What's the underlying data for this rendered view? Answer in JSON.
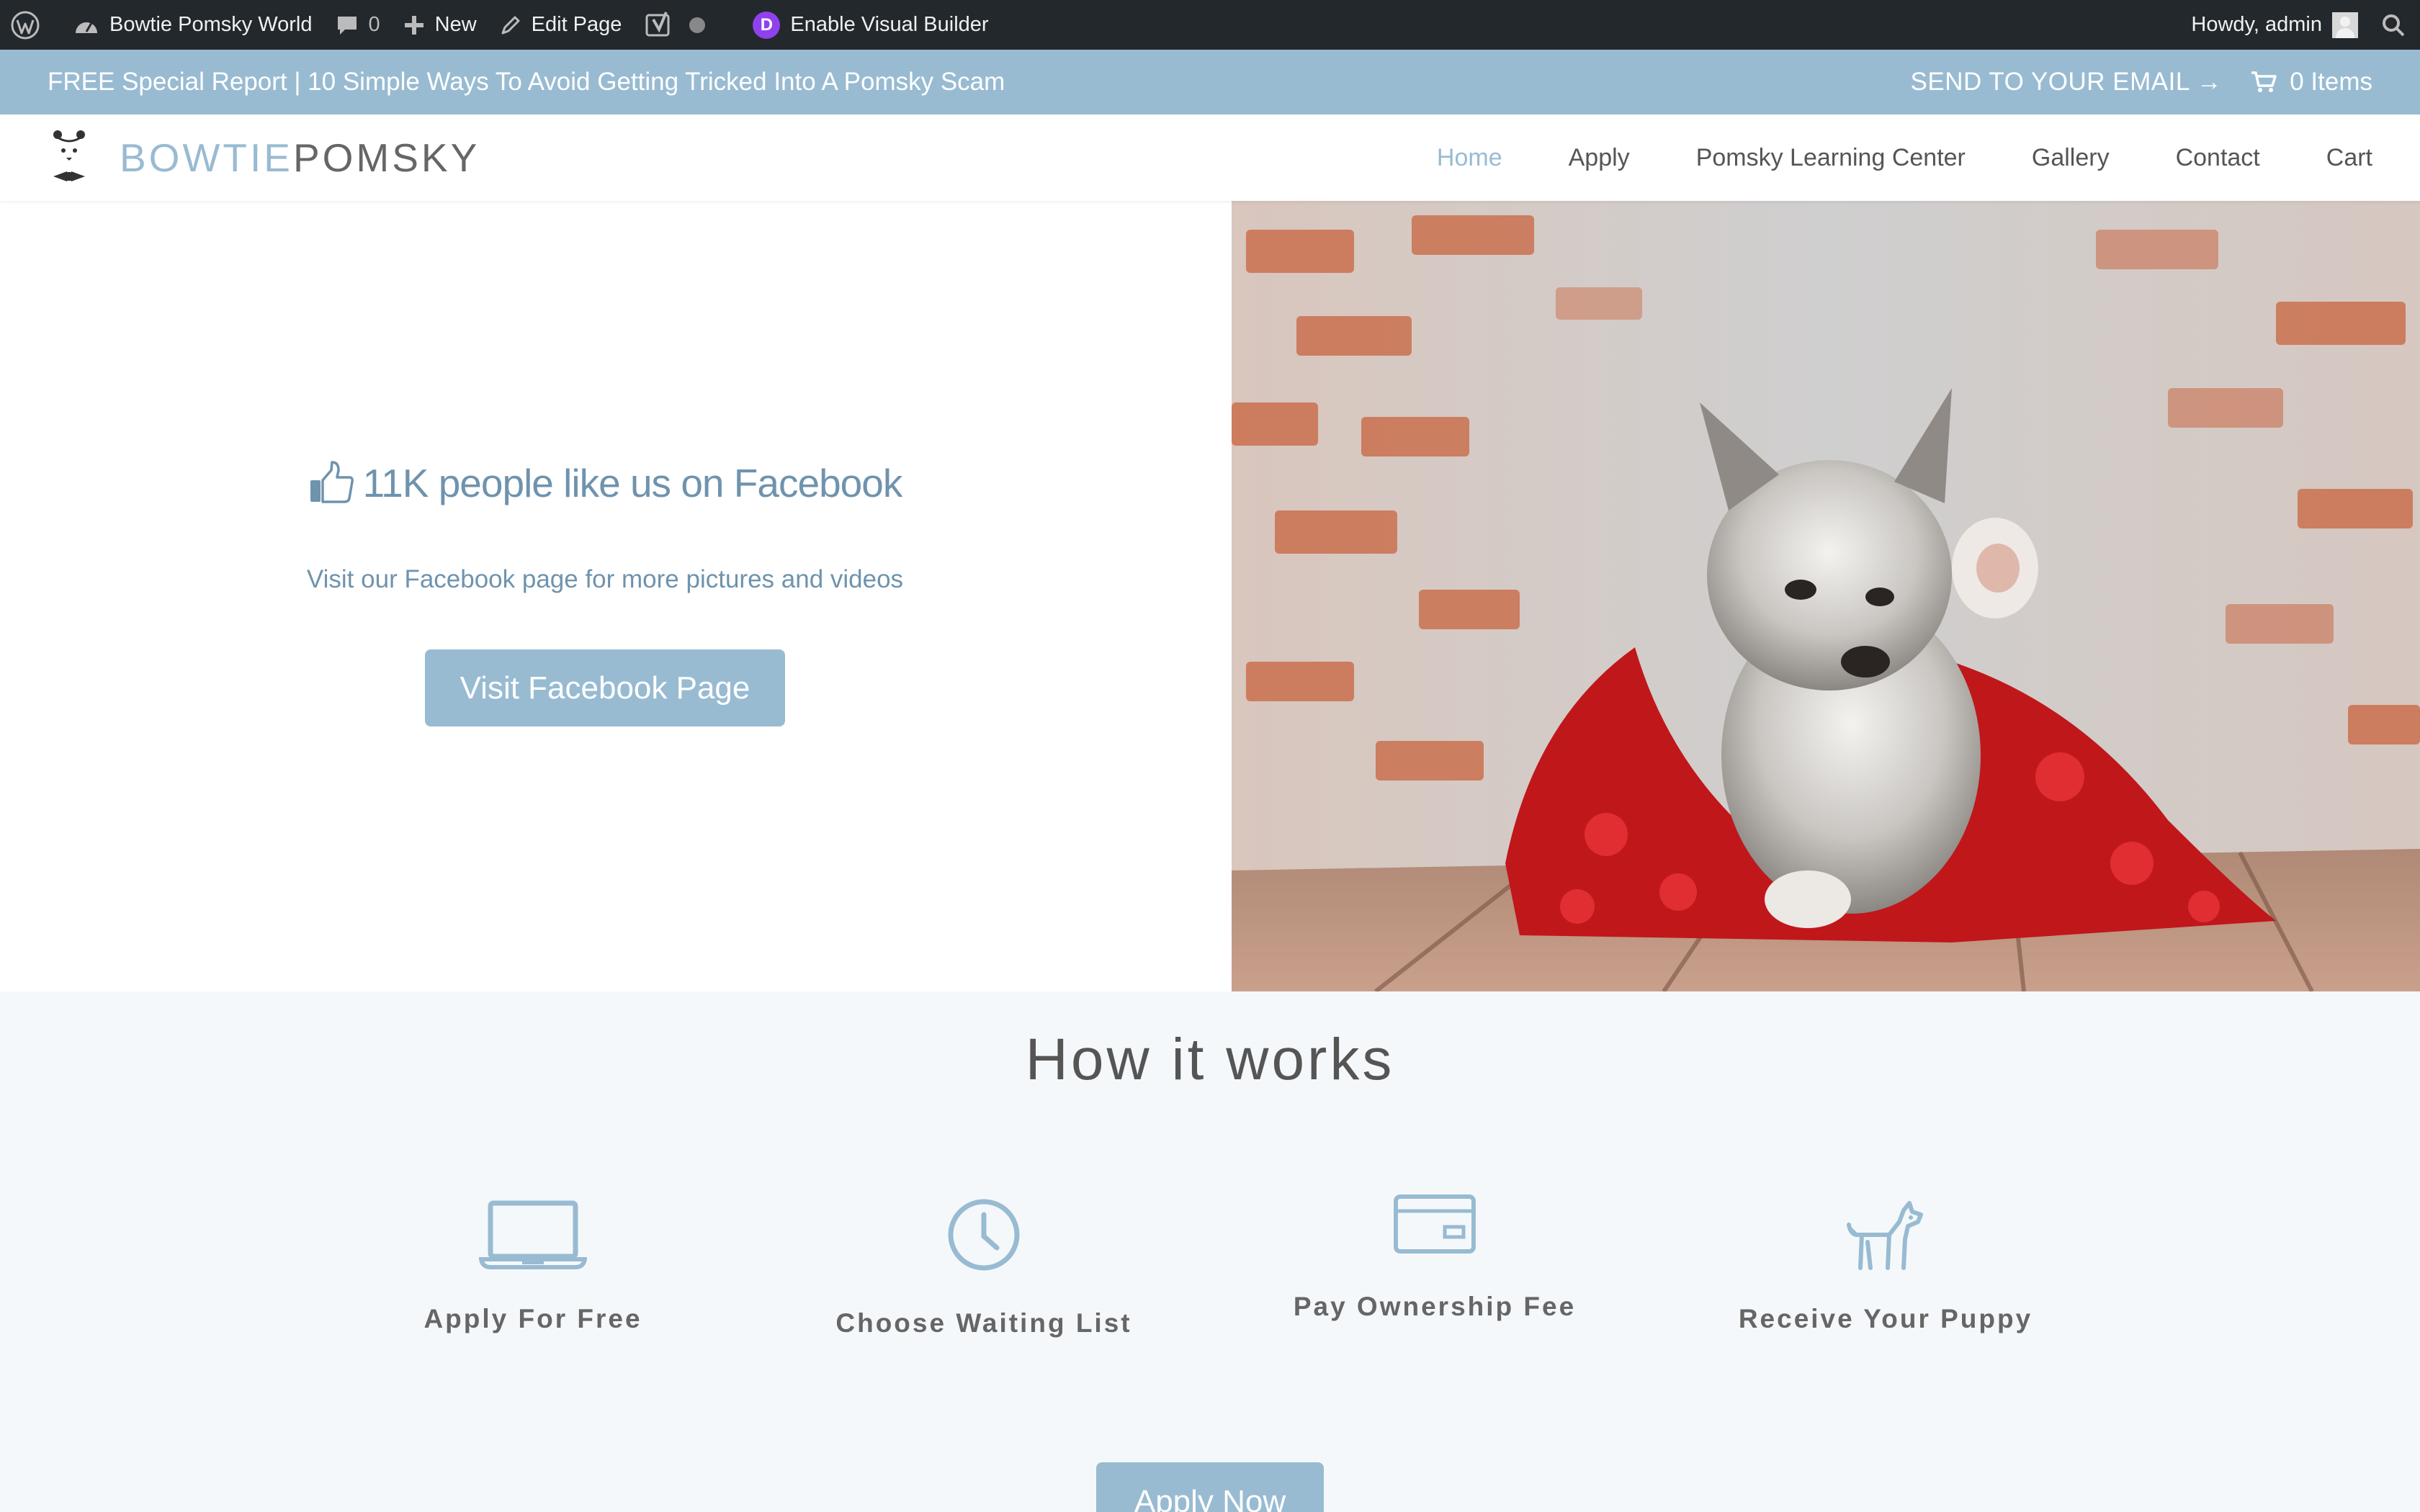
{
  "admin_bar": {
    "site_name": "Bowtie Pomsky World",
    "comments_count": "0",
    "new_label": "New",
    "edit_label": "Edit Page",
    "builder_label": "Enable Visual Builder",
    "divi_letter": "D",
    "howdy": "Howdy, admin",
    "icons": [
      "wordpress-icon",
      "dashboard-icon",
      "comment-icon",
      "plus-icon",
      "pencil-icon",
      "yoast-icon",
      "status-dot-icon",
      "divi-icon",
      "avatar",
      "search-icon"
    ]
  },
  "promo_bar": {
    "text": "FREE Special Report | 10 Simple Ways To Avoid Getting Tricked Into A Pomsky Scam",
    "email_cta": "SEND TO YOUR EMAIL →",
    "cart_label": "0 Items"
  },
  "header": {
    "logo_part1": "BOWTIE",
    "logo_part2": "POMSKY",
    "nav": [
      {
        "label": "Home",
        "active": true
      },
      {
        "label": "Apply"
      },
      {
        "label": "Pomsky Learning Center"
      },
      {
        "label": "Gallery"
      },
      {
        "label": "Contact"
      },
      {
        "label": "Cart"
      }
    ]
  },
  "hero": {
    "title": "11K people like us on Facebook",
    "subtitle": "Visit our Facebook page for more pictures and videos",
    "button": "Visit Facebook Page"
  },
  "how_it_works": {
    "title": "How it works",
    "steps": [
      {
        "label": "Apply For Free",
        "icon": "laptop-icon"
      },
      {
        "label": "Choose Waiting List",
        "icon": "clock-icon"
      },
      {
        "label": "Pay Ownership Fee",
        "icon": "credit-card-icon"
      },
      {
        "label": "Receive Your Puppy",
        "icon": "dog-icon"
      }
    ],
    "button": "Apply Now"
  },
  "colors": {
    "accent": "#98bbd2",
    "accent_text": "#6f93ad",
    "admin_bar": "#23282d",
    "divi": "#8f42ec"
  }
}
